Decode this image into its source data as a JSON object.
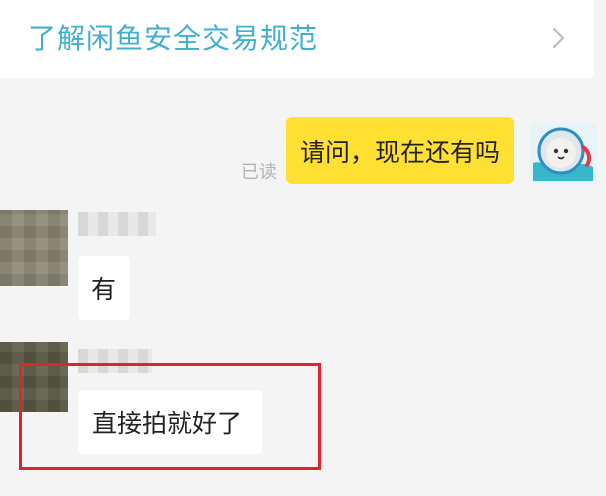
{
  "banner": {
    "text": "了解闲鱼安全交易规范",
    "icon": "chevron-right-icon",
    "color": "#3fb1cf"
  },
  "messages": [
    {
      "side": "right",
      "text": "请问，现在还有吗",
      "status": "已读",
      "bubble_color": "#ffe033"
    },
    {
      "side": "left",
      "text": "有",
      "sender_name": ""
    },
    {
      "side": "left",
      "text": "直接拍就好了",
      "sender_name": "",
      "highlighted": true
    }
  ],
  "colors": {
    "background": "#f4f4f5",
    "highlight": "#e0232d"
  }
}
